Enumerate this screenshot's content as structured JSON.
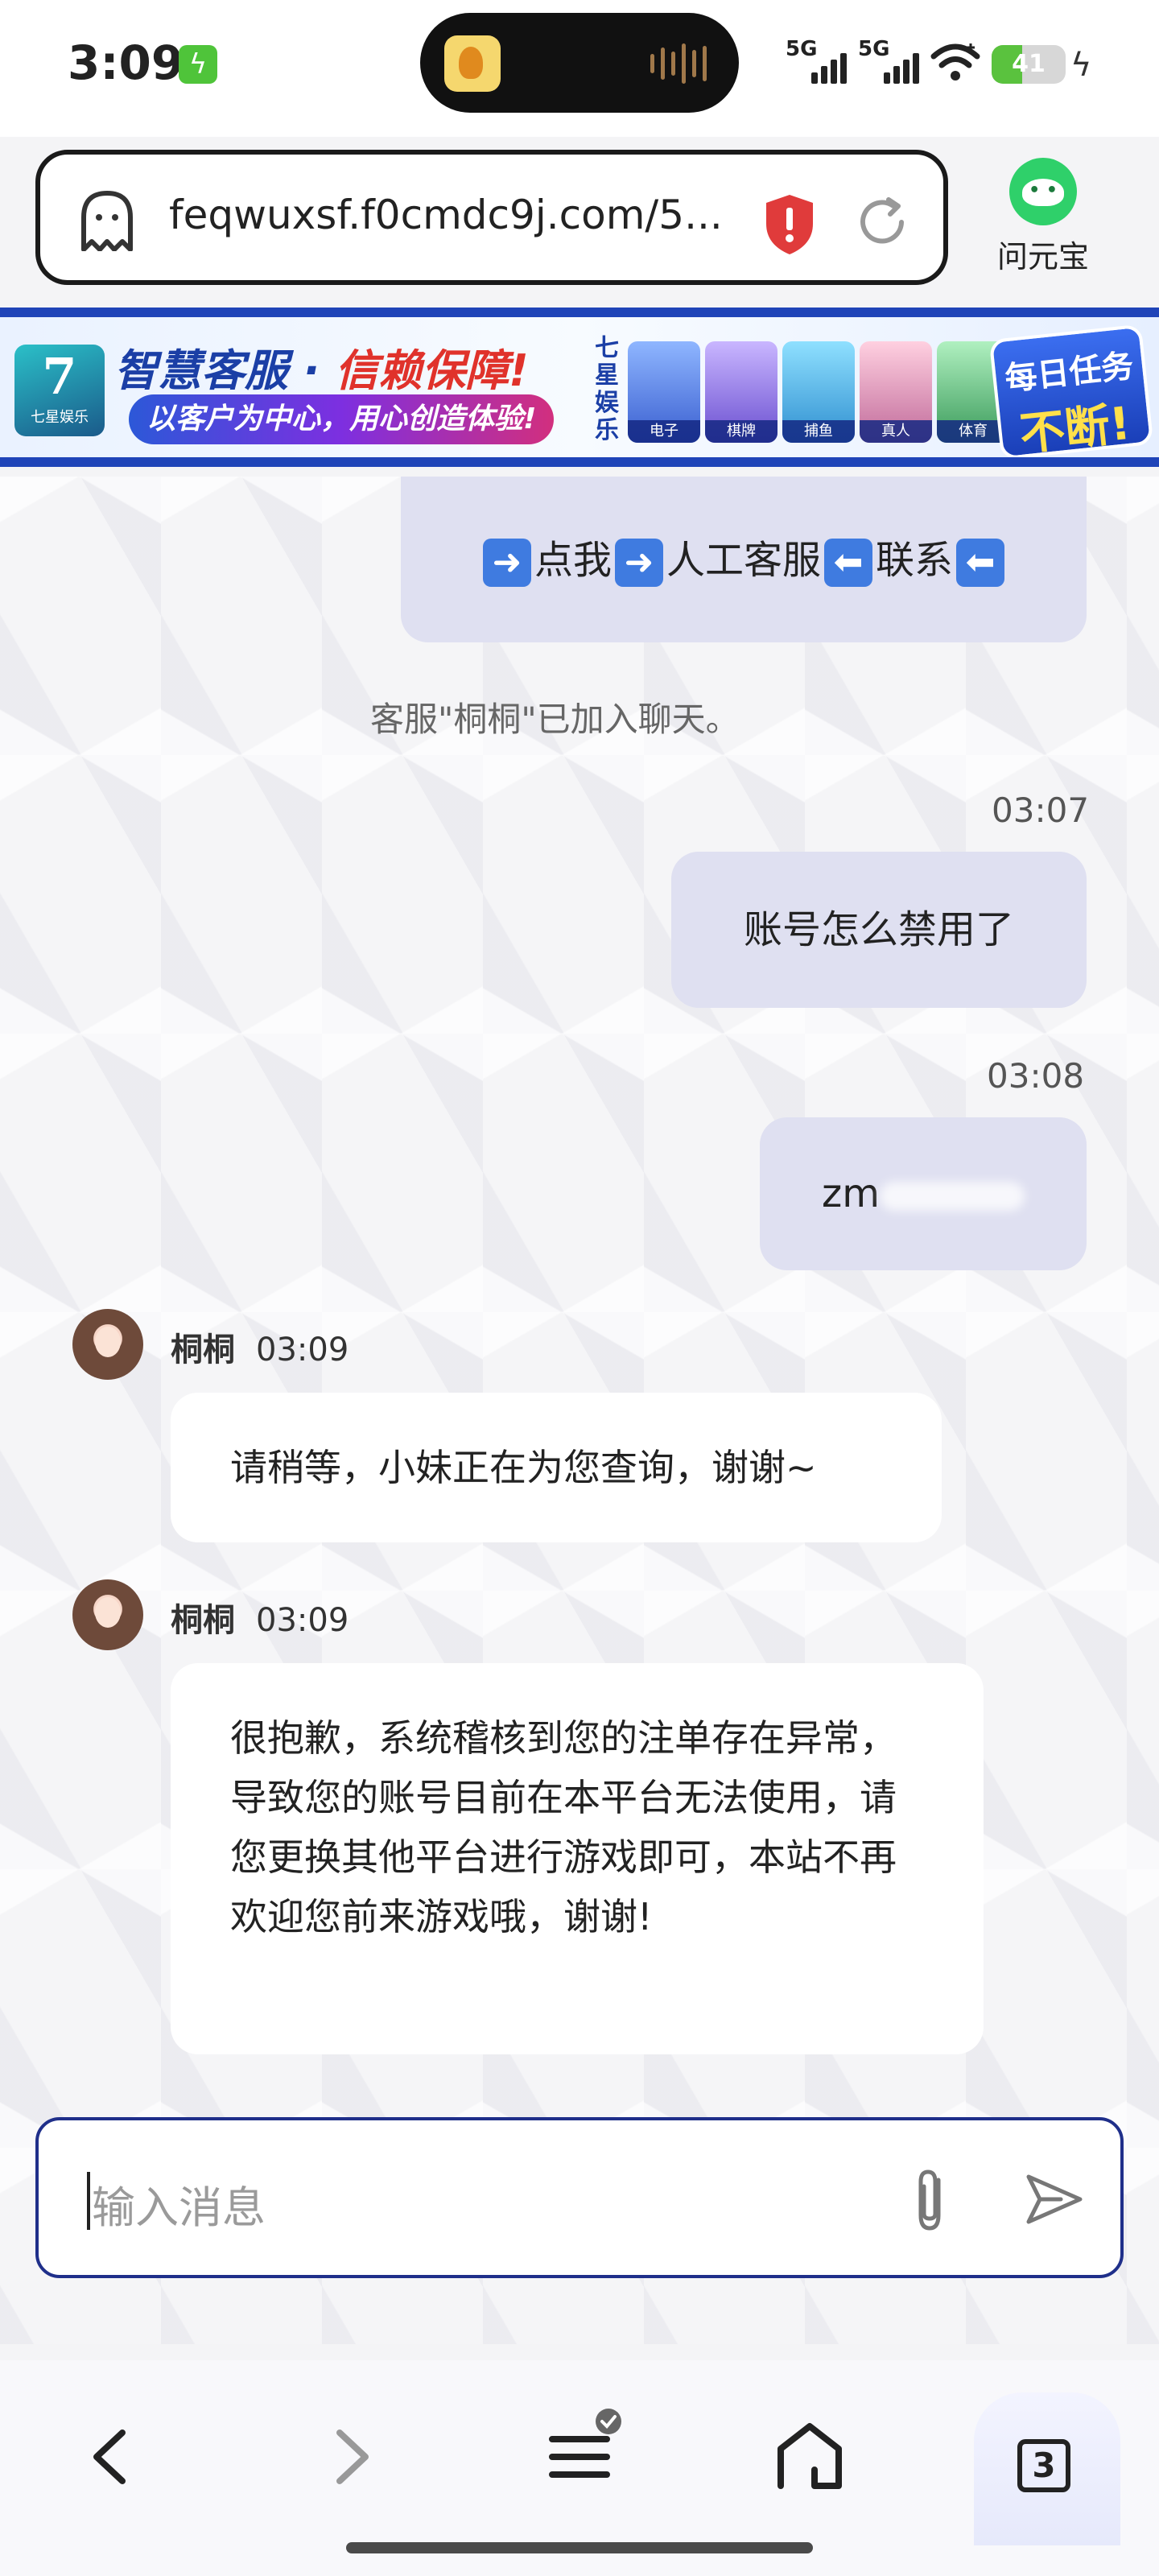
{
  "status_bar": {
    "time": "3:09",
    "network1": "5G",
    "network2": "5G",
    "battery": "41",
    "battery_level": 0.41
  },
  "browser": {
    "url": "feqwuxsf.f0cmdc9j.com/5...",
    "assistant_label": "问元宝",
    "tabs_count": "3"
  },
  "banner": {
    "logo_text": "七星娱乐",
    "logo_letter": "7",
    "title_part1": "智慧客服",
    "title_sep": " · ",
    "title_part2": "信赖保障!",
    "subtitle": "以客户为中心，用心创造体验!",
    "vertical_text": "七星娱乐",
    "categories": [
      "电子",
      "棋牌",
      "捕鱼",
      "真人",
      "体育"
    ],
    "badge_line1": "每日任务",
    "badge_line2": "不断!"
  },
  "chat": {
    "service_prompt": {
      "part1": "点我",
      "part2": "人工客服",
      "part3": "联系"
    },
    "system_message": "客服\"桐桐\"已加入聊天。",
    "messages": [
      {
        "side": "right",
        "time": "03:07",
        "text": "账号怎么禁用了"
      },
      {
        "side": "right",
        "time": "03:08",
        "text": "zm"
      },
      {
        "side": "left",
        "sender": "桐桐",
        "time": "03:09",
        "text": "请稍等，小妹正在为您查询，谢谢~"
      },
      {
        "side": "left",
        "sender": "桐桐",
        "time": "03:09",
        "text": "很抱歉，系统稽核到您的注单存在异常，导致您的账号目前在本平台无法使用，请您更换其他平台进行游戏即可，本站不再欢迎您前来游戏哦，谢谢!"
      }
    ]
  },
  "input": {
    "placeholder": "输入消息"
  },
  "colors": {
    "accent": "#1f44b8",
    "bubble_right": "#dfe0f1",
    "bubble_left": "#ffffff",
    "warning": "#e03b3b",
    "assistant_green": "#2fd06a"
  },
  "icons": [
    "charge-icon",
    "signal-icon",
    "wifi-icon",
    "ghost-icon",
    "shield-warning-icon",
    "reload-icon",
    "attach-icon",
    "send-icon",
    "back-icon",
    "forward-icon",
    "menu-icon",
    "home-icon",
    "tabs-icon"
  ]
}
